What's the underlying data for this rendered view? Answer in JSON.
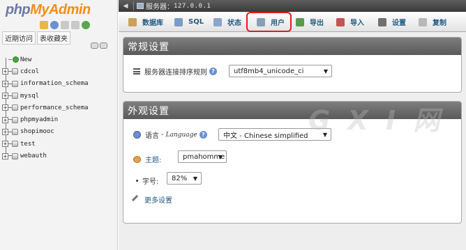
{
  "logo": {
    "part1": "php",
    "part2": "MyAdmin"
  },
  "nav": {
    "tabs": [
      "近期访问",
      "表收藏夹"
    ],
    "new_label": "New",
    "databases": [
      "cdcol",
      "information_schema",
      "mysql",
      "performance_schema",
      "phpmyadmin",
      "shopimooc",
      "test",
      "webauth"
    ]
  },
  "server_bar": {
    "label": "服务器：",
    "address": "127.0.0.1"
  },
  "menu": [
    {
      "label": "数据库",
      "icon": "database-icon",
      "color": "#c9a25a"
    },
    {
      "label": "SQL",
      "icon": "sql-icon",
      "color": "#7a9cc6"
    },
    {
      "label": "状态",
      "icon": "status-icon",
      "color": "#8aa6c8"
    },
    {
      "label": "用户",
      "icon": "users-icon",
      "color": "#8b9eb8"
    },
    {
      "label": "导出",
      "icon": "export-icon",
      "color": "#5a9a4c"
    },
    {
      "label": "导入",
      "icon": "import-icon",
      "color": "#c35454"
    },
    {
      "label": "设置",
      "icon": "wrench-icon",
      "color": "#707070"
    },
    {
      "label": "复制",
      "icon": "replication-icon",
      "color": "#b8b8b8"
    }
  ],
  "general": {
    "title": "常规设置",
    "collation_label": "服务器连接排序规则",
    "collation_value": "utf8mb4_unicode_ci"
  },
  "appearance": {
    "title": "外观设置",
    "language_label": "语言",
    "language_label_en": "Language",
    "language_value": "中文 - Chinese simplified",
    "theme_label": "主题:",
    "theme_value": "pmahomme",
    "fontsize_label": "字号:",
    "fontsize_value": "82%",
    "more_settings": "更多设置"
  },
  "watermark": "G X I 网",
  "accent_color": "#235a81",
  "highlight_color": "#e31c1c"
}
